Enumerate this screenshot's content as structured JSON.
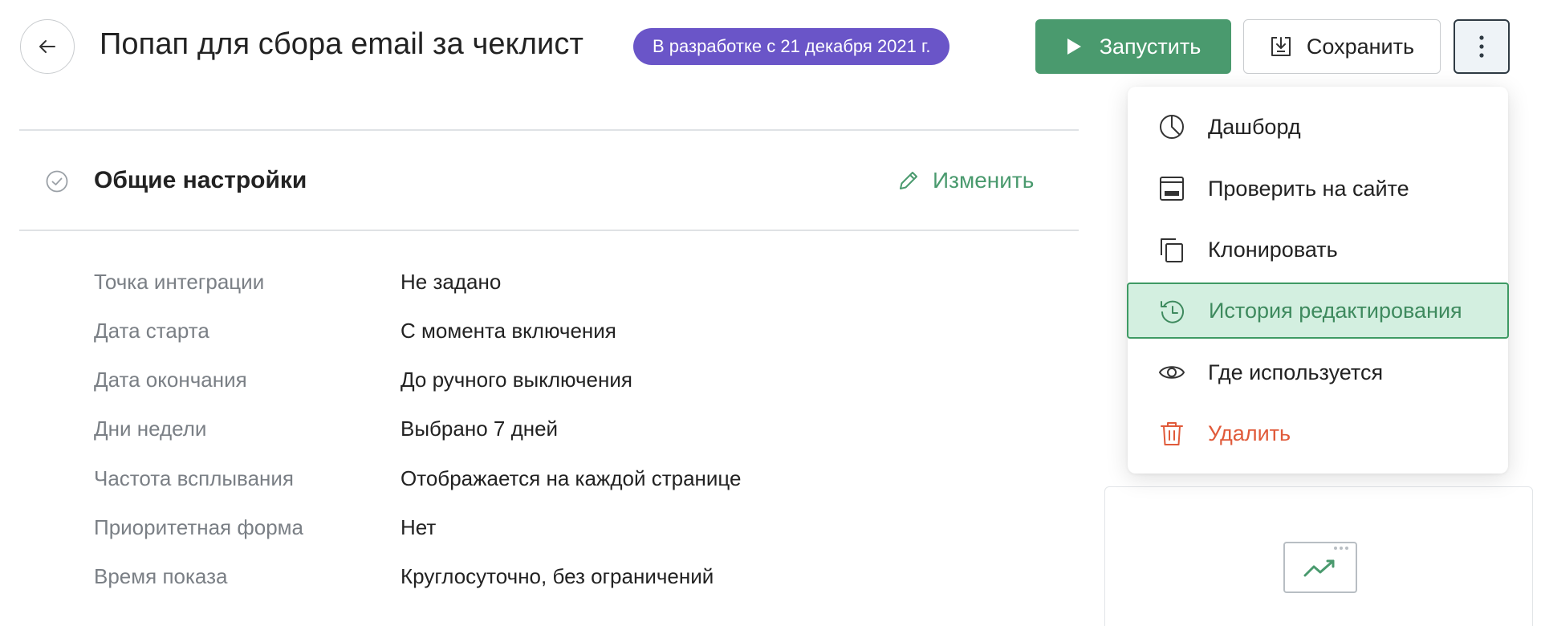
{
  "header": {
    "title": "Попап для сбора email за чеклист",
    "status_badge": "В разработке с 21 декабря 2021 г.",
    "run_label": "Запустить",
    "save_label": "Сохранить"
  },
  "section": {
    "title": "Общие настройки",
    "edit_label": "Изменить",
    "rows": [
      {
        "key": "Точка интеграции",
        "value": "Не задано"
      },
      {
        "key": "Дата старта",
        "value": "С момента включения"
      },
      {
        "key": "Дата окончания",
        "value": "До ручного выключения"
      },
      {
        "key": "Дни недели",
        "value": "Выбрано 7 дней"
      },
      {
        "key": "Частота всплывания",
        "value": "Отображается на каждой странице"
      },
      {
        "key": "Приоритетная форма",
        "value": "Нет"
      },
      {
        "key": "Время показа",
        "value": "Круглосуточно, без ограничений"
      }
    ]
  },
  "menu": {
    "items": [
      {
        "label": "Дашборд",
        "icon": "pie-chart-icon",
        "state": "normal"
      },
      {
        "label": "Проверить на сайте",
        "icon": "browser-window-icon",
        "state": "normal"
      },
      {
        "label": "Клонировать",
        "icon": "copy-icon",
        "state": "normal"
      },
      {
        "label": "История редактирования",
        "icon": "history-icon",
        "state": "hovered"
      },
      {
        "label": "Где используется",
        "icon": "eye-icon",
        "state": "normal"
      },
      {
        "label": "Удалить",
        "icon": "trash-icon",
        "state": "danger"
      }
    ]
  },
  "colors": {
    "primary_green": "#4a9a6e",
    "badge_purple": "#6a55c8",
    "danger_red": "#e05a3a",
    "hover_bg": "#d3efe0",
    "muted_text": "#7a7f85"
  }
}
